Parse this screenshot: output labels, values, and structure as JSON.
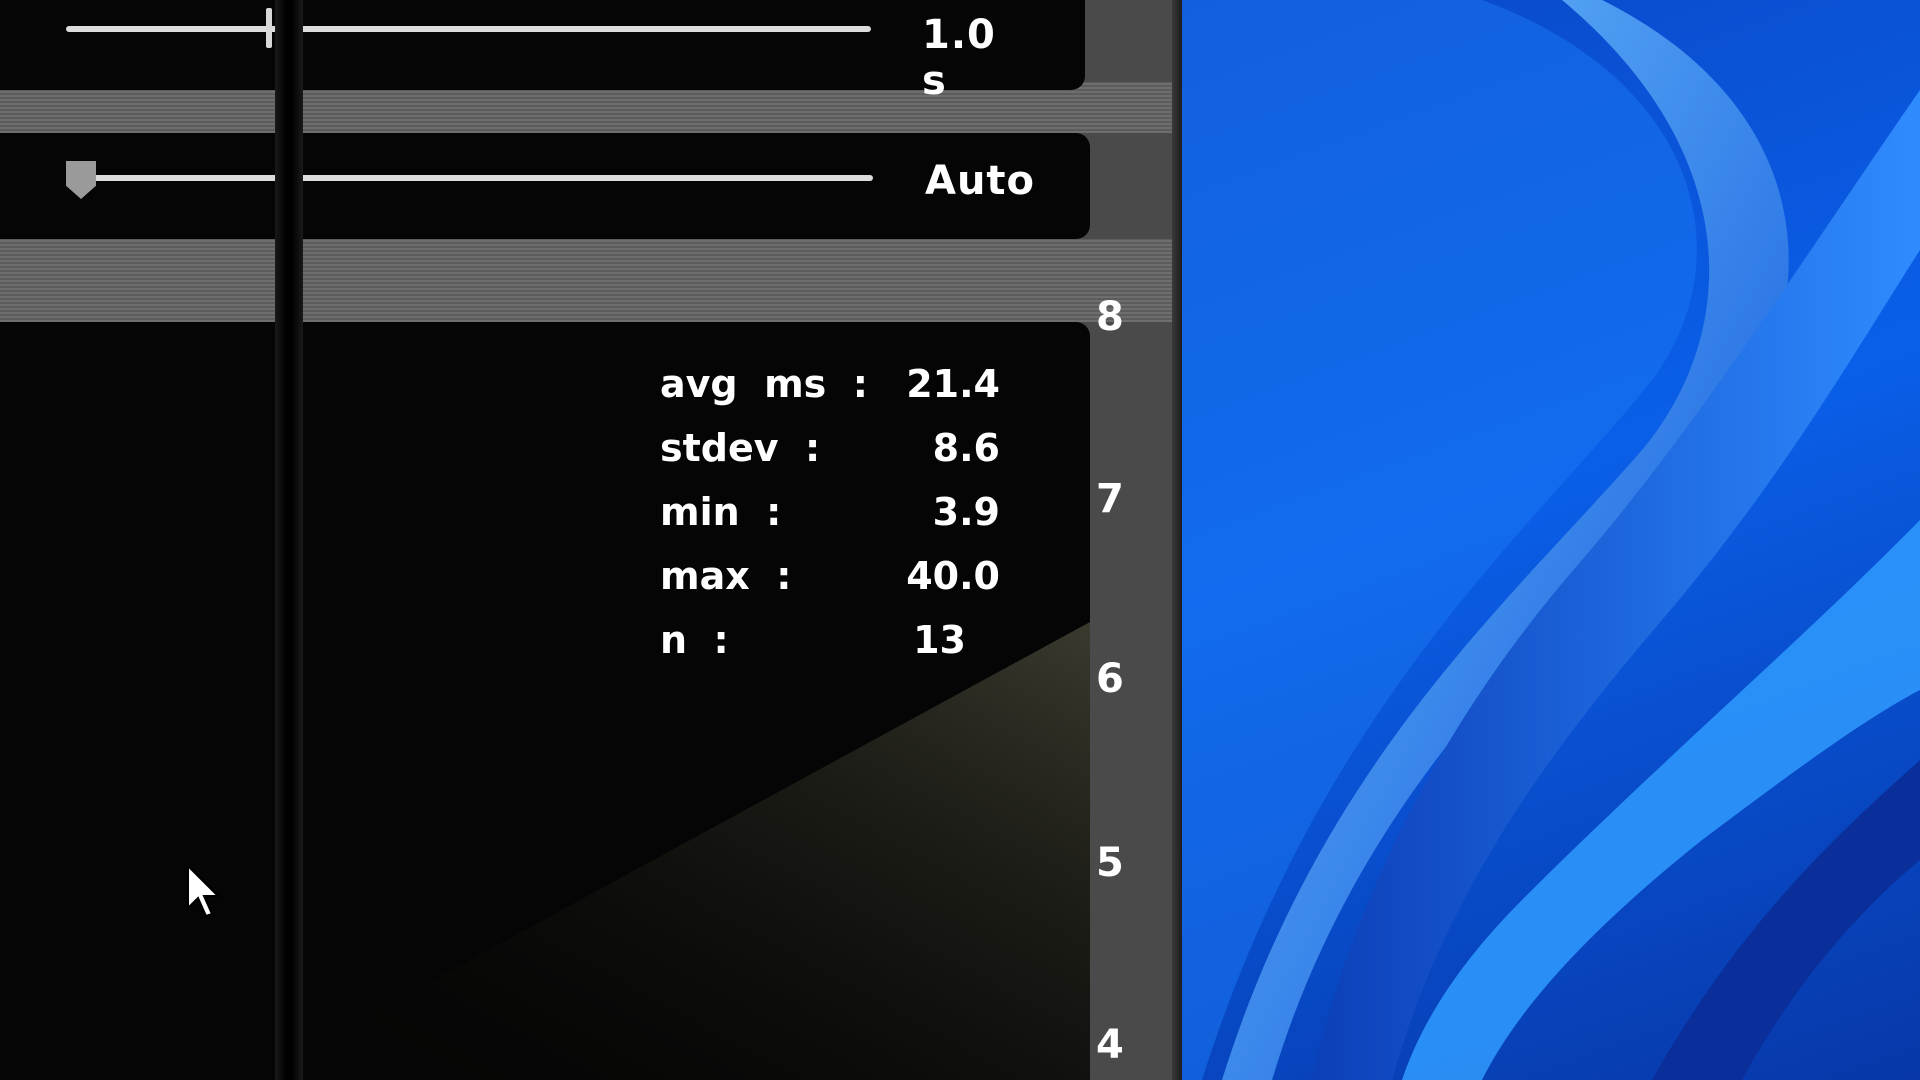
{
  "duration_slider": {
    "value_label": "1.0 s",
    "position": 0.25
  },
  "scale_slider": {
    "value_label": "Auto",
    "position": 0.0
  },
  "stats": [
    {
      "label": "avg  ms  :",
      "value": "21.4"
    },
    {
      "label": "stdev  :",
      "value": "8.6"
    },
    {
      "label": "min  :",
      "value": "3.9"
    },
    {
      "label": "max  :",
      "value": "40.0"
    },
    {
      "label": "n  :",
      "value": "13"
    }
  ],
  "y_axis_ticks": [
    "8",
    "7",
    "6",
    "5",
    "4"
  ],
  "colors": {
    "panel": "#050505",
    "band": "#5c5c5c",
    "text": "#ffffff",
    "wallpaper": "#0a5fe8"
  },
  "icons": {
    "cursor": "arrow-pointer-icon"
  }
}
